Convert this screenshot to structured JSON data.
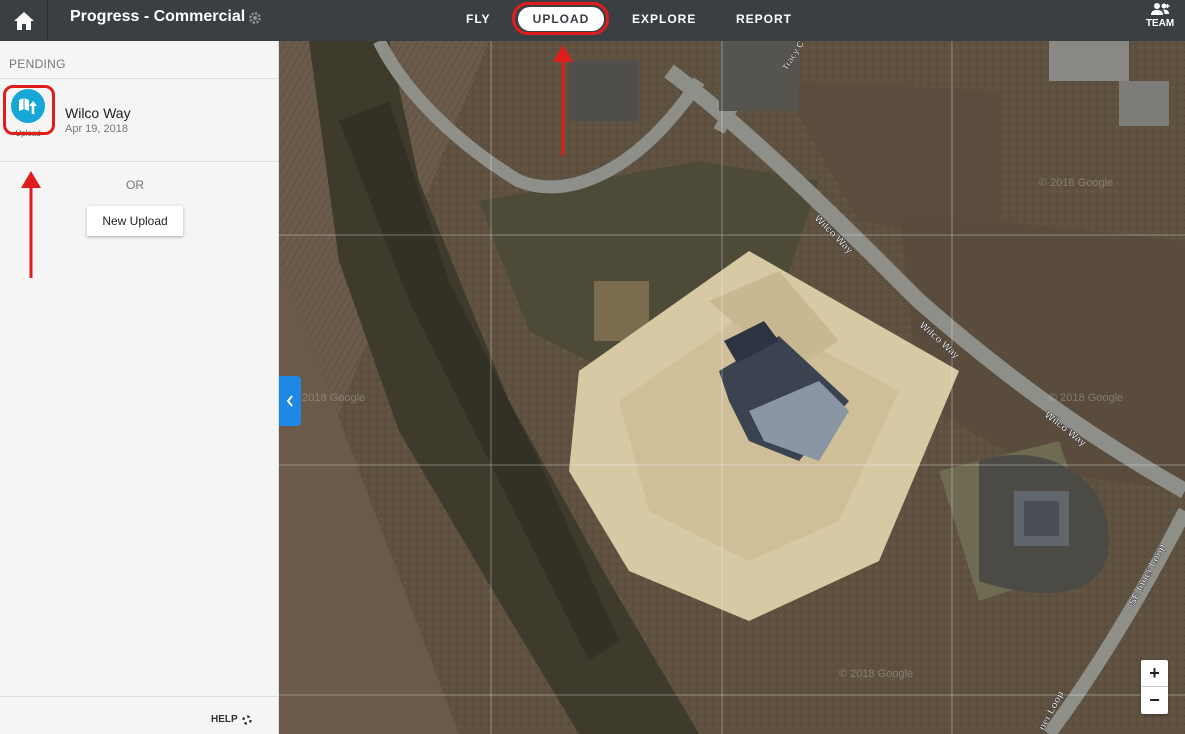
{
  "header": {
    "project_title": "Progress - Commercial",
    "nav": {
      "fly": "FLY",
      "upload": "UPLOAD",
      "explore": "EXPLORE",
      "report": "REPORT"
    },
    "team_label": "TEAM"
  },
  "sidebar": {
    "section_title": "PENDING",
    "pending_item": {
      "name": "Wilco Way",
      "date": "Apr 19, 2018",
      "icon_label": "Upload"
    },
    "or_text": "OR",
    "new_upload_label": "New Upload",
    "help_label": "HELP"
  },
  "map": {
    "road_labels": [
      "Wilco Way",
      "Wilco Way",
      "Wilco Way",
      "SE Inner Loop",
      "Tracy C",
      "ner Loop"
    ],
    "watermarks": [
      "© 2018 Google",
      "© 2018 Google",
      "© 2018 Google",
      "© 2018 Google"
    ],
    "zoom_in": "+",
    "zoom_out": "−"
  },
  "colors": {
    "header_bg": "#3a3f44",
    "accent_blue": "#17a7d6",
    "collapse_blue": "#1e88e5",
    "annotation_red": "#e01d1d"
  }
}
